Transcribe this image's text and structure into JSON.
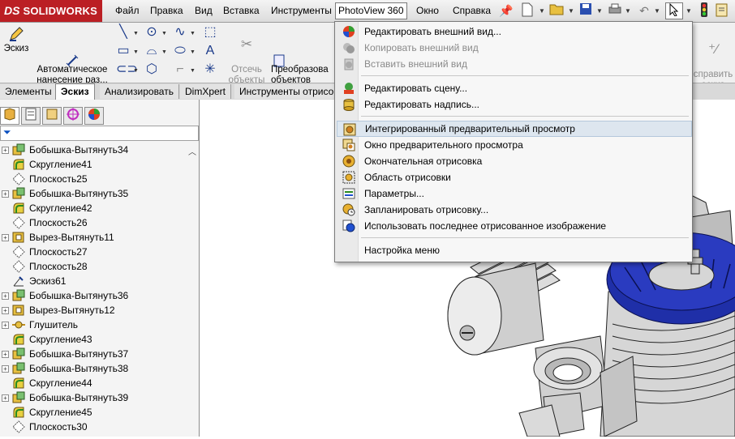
{
  "app": {
    "logo_ds": "DS",
    "logo_name": "SOLIDWORKS"
  },
  "menubar": {
    "items": [
      "Файл",
      "Правка",
      "Вид",
      "Вставка",
      "Инструменты",
      "PhotoView 360",
      "Окно",
      "Справка"
    ],
    "active_index": 5
  },
  "command_manager": {
    "sketch": "Эскиз",
    "auto_dim": "Автоматическое\nнанесение раз...",
    "trim": "Отсечь\nобъекты",
    "convert": "Преобразова\nобъектов",
    "right_partial": "справить\nэскиз"
  },
  "tabs": [
    "Элементы",
    "Эскиз",
    "Анализировать",
    "DimXpert",
    "Инструменты отрисо"
  ],
  "active_tab": 1,
  "feature_tree": [
    {
      "label": "Бобышка-Вытянуть34",
      "icon": "boss-extrude-icon",
      "expandable": true
    },
    {
      "label": "Скругление41",
      "icon": "fillet-icon",
      "expandable": false
    },
    {
      "label": "Плоскость25",
      "icon": "plane-icon",
      "expandable": false
    },
    {
      "label": "Бобышка-Вытянуть35",
      "icon": "boss-extrude-icon",
      "expandable": true
    },
    {
      "label": "Скругление42",
      "icon": "fillet-icon",
      "expandable": false
    },
    {
      "label": "Плоскость26",
      "icon": "plane-icon",
      "expandable": false
    },
    {
      "label": "Вырез-Вытянуть11",
      "icon": "cut-extrude-icon",
      "expandable": true
    },
    {
      "label": "Плоскость27",
      "icon": "plane-icon",
      "expandable": false
    },
    {
      "label": "Плоскость28",
      "icon": "plane-icon",
      "expandable": false
    },
    {
      "label": "Эскиз61",
      "icon": "sketch-icon",
      "expandable": false
    },
    {
      "label": "Бобышка-Вытянуть36",
      "icon": "boss-extrude-icon",
      "expandable": true
    },
    {
      "label": "Вырез-Вытянуть12",
      "icon": "cut-extrude-icon",
      "expandable": true
    },
    {
      "label": "Глушитель",
      "icon": "component-icon",
      "expandable": true
    },
    {
      "label": "Скругление43",
      "icon": "fillet-icon",
      "expandable": false
    },
    {
      "label": "Бобышка-Вытянуть37",
      "icon": "boss-extrude-icon",
      "expandable": true
    },
    {
      "label": "Бобышка-Вытянуть38",
      "icon": "boss-extrude-icon",
      "expandable": true
    },
    {
      "label": "Скругление44",
      "icon": "fillet-icon",
      "expandable": false
    },
    {
      "label": "Бобышка-Вытянуть39",
      "icon": "boss-extrude-icon",
      "expandable": true
    },
    {
      "label": "Скругление45",
      "icon": "fillet-icon",
      "expandable": false
    },
    {
      "label": "Плоскость30",
      "icon": "plane-icon",
      "expandable": false
    }
  ],
  "photoview_menu": [
    {
      "type": "item",
      "label": "Редактировать внешний вид...",
      "icon": "appearance-icon",
      "enabled": true
    },
    {
      "type": "item",
      "label": "Копировать внешний вид",
      "icon": "copy-appearance-icon",
      "enabled": false
    },
    {
      "type": "item",
      "label": "Вставить внешний вид",
      "icon": "paste-appearance-icon",
      "enabled": false
    },
    {
      "type": "sep"
    },
    {
      "type": "item",
      "label": "Редактировать сцену...",
      "icon": "scene-icon",
      "enabled": true
    },
    {
      "type": "item",
      "label": "Редактировать надпись...",
      "icon": "decal-icon",
      "enabled": true
    },
    {
      "type": "sep"
    },
    {
      "type": "item",
      "label": "Интегрированный предварительный просмотр",
      "icon": "integrated-preview-icon",
      "enabled": true,
      "hover": true
    },
    {
      "type": "item",
      "label": "Окно предварительного просмотра",
      "icon": "preview-window-icon",
      "enabled": true
    },
    {
      "type": "item",
      "label": "Окончательная отрисовка",
      "icon": "final-render-icon",
      "enabled": true
    },
    {
      "type": "item",
      "label": "Область отрисовки",
      "icon": "render-region-icon",
      "enabled": true
    },
    {
      "type": "item",
      "label": "Параметры...",
      "icon": "options-icon",
      "enabled": true
    },
    {
      "type": "item",
      "label": "Запланировать отрисовку...",
      "icon": "schedule-render-icon",
      "enabled": true
    },
    {
      "type": "item",
      "label": "Использовать последнее отрисованное изображение",
      "icon": "last-render-icon",
      "enabled": true
    },
    {
      "type": "sep"
    },
    {
      "type": "item",
      "label": "Настройка меню",
      "icon": "",
      "enabled": true
    }
  ],
  "colors": {
    "brand_red": "#bb1f24",
    "menu_hover": "#dde6ef",
    "model_blue": "#1f2fa8",
    "model_gray": "#c8c8c8"
  }
}
